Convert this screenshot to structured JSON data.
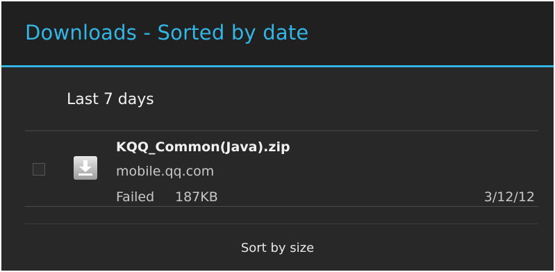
{
  "dialog": {
    "title": "Downloads - Sorted by date",
    "accent_color": "#33b5e5"
  },
  "section": {
    "header": "Last 7 days"
  },
  "downloads": [
    {
      "file_name": "KQQ_Common(Java).zip",
      "source": "mobile.qq.com",
      "status": "Failed",
      "size": "187KB",
      "date": "3/12/12",
      "checked": false,
      "icon": "download-icon"
    }
  ],
  "footer": {
    "sort_label": "Sort by size"
  }
}
